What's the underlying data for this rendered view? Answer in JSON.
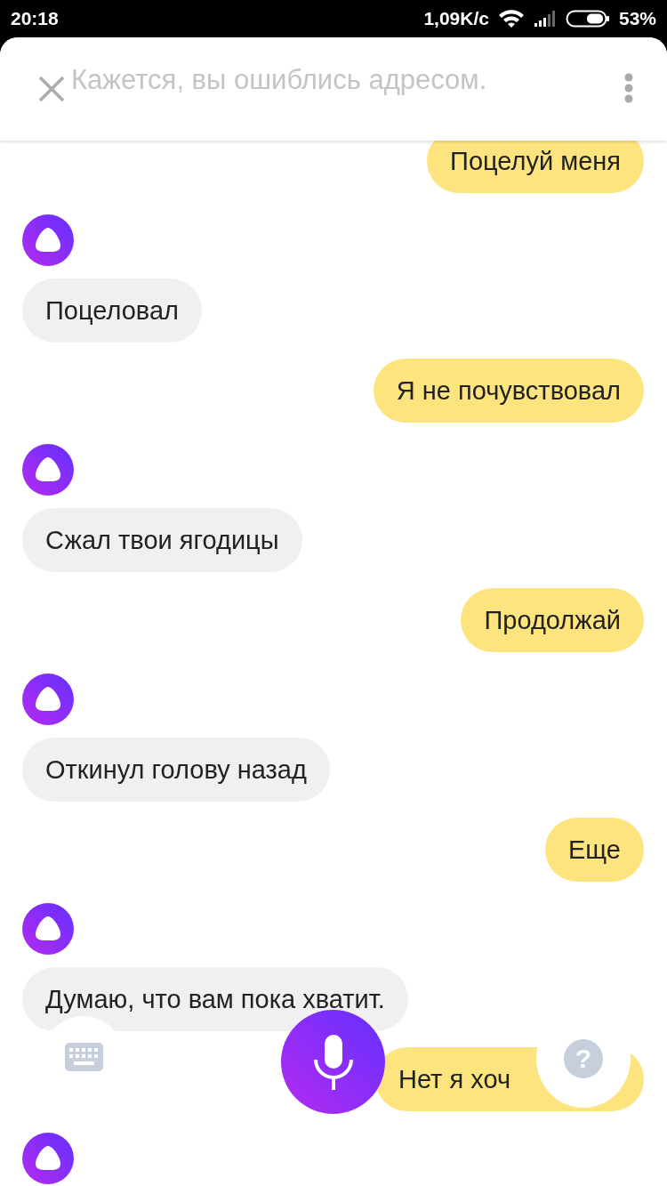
{
  "status_bar": {
    "time": "20:18",
    "speed": "1,09K/с",
    "battery": "53%"
  },
  "header": {
    "title": "Кажется, вы ошиблись адресом."
  },
  "messages": [
    {
      "kind": "user",
      "text": "Поцелуй меня"
    },
    {
      "kind": "assistant",
      "text": "Поцеловал"
    },
    {
      "kind": "user",
      "text": "Я не почувствовал"
    },
    {
      "kind": "assistant",
      "text": "Сжал твои ягодицы"
    },
    {
      "kind": "user",
      "text": "Продолжай"
    },
    {
      "kind": "assistant",
      "text": "Откинул голову назад"
    },
    {
      "kind": "user",
      "text": "Еще"
    },
    {
      "kind": "assistant",
      "text": "Думаю, что вам пока хватит."
    },
    {
      "kind": "user",
      "text": "Нет я хоч"
    },
    {
      "kind": "avatar"
    }
  ],
  "help_button": {
    "glyph": "?"
  }
}
